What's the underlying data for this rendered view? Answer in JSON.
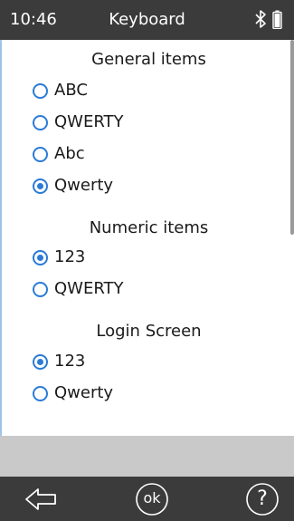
{
  "status_bar": {
    "time": "10:46",
    "title": "Keyboard"
  },
  "sections": [
    {
      "header": "General items",
      "options": [
        {
          "label": "ABC",
          "selected": false
        },
        {
          "label": "QWERTY",
          "selected": false
        },
        {
          "label": "Abc",
          "selected": false
        },
        {
          "label": "Qwerty",
          "selected": true
        }
      ]
    },
    {
      "header": "Numeric items",
      "options": [
        {
          "label": "123",
          "selected": true
        },
        {
          "label": "QWERTY",
          "selected": false
        }
      ]
    },
    {
      "header": "Login Screen",
      "options": [
        {
          "label": "123",
          "selected": true
        },
        {
          "label": "Qwerty",
          "selected": false
        }
      ]
    }
  ],
  "nav": {
    "ok_label": "ok",
    "help_label": "?"
  },
  "colors": {
    "accent": "#2b7bd6",
    "bar": "#3b3b3b",
    "band": "#c9c9c9"
  },
  "icons": [
    "bluetooth-icon",
    "battery-icon",
    "back-arrow-icon",
    "ok-icon",
    "help-icon"
  ]
}
